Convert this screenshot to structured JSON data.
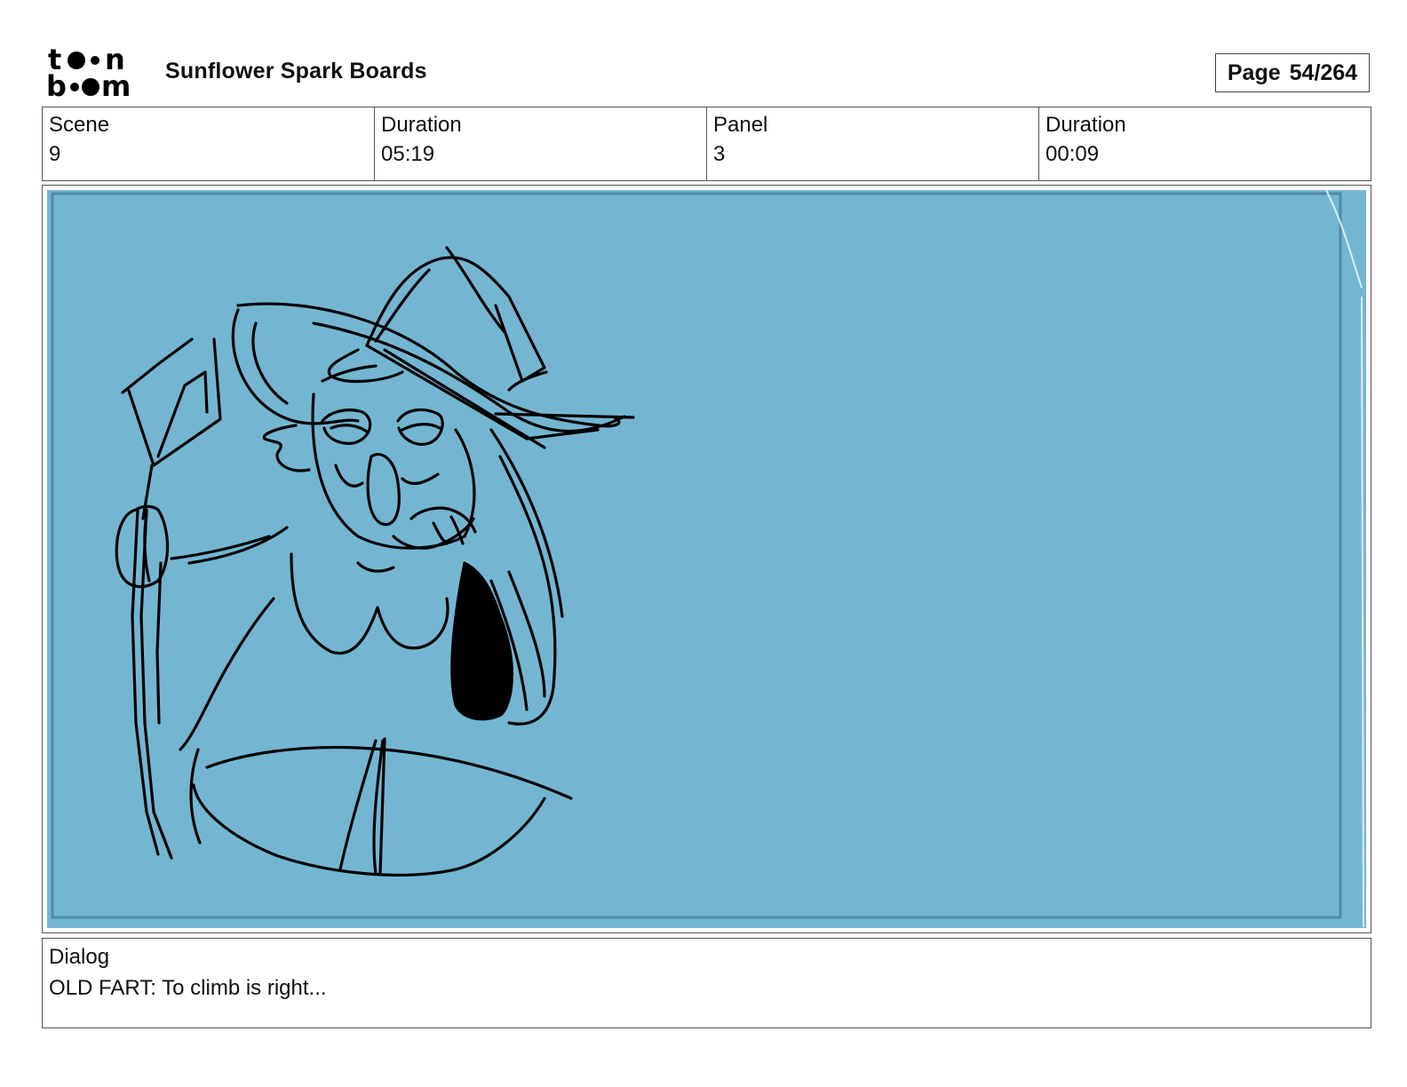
{
  "header": {
    "logo_text": "toon boom",
    "title": "Sunflower Spark Boards",
    "page_label": "Page",
    "page_value": "54/264"
  },
  "meta": [
    {
      "label": "Scene",
      "value": "9"
    },
    {
      "label": "Duration",
      "value": "05:19"
    },
    {
      "label": "Panel",
      "value": "3"
    },
    {
      "label": "Duration",
      "value": "00:09"
    }
  ],
  "panel": {
    "background_color": "#74b6d2",
    "sketch_color": "#000000"
  },
  "dialog": {
    "label": "Dialog",
    "text": "OLD FART: To climb is right..."
  }
}
